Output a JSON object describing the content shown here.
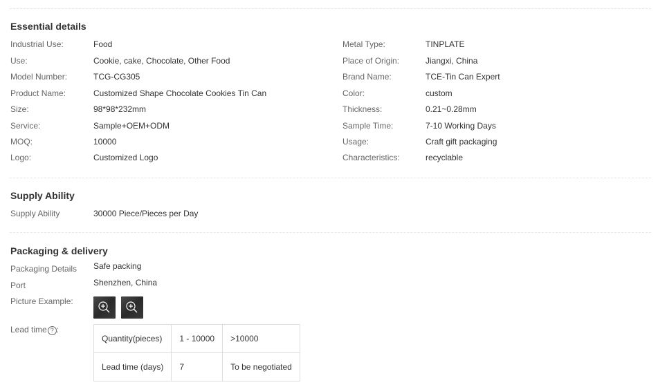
{
  "essential": {
    "title": "Essential details",
    "left": [
      {
        "label": "Industrial Use:",
        "value": "Food"
      },
      {
        "label": "Use:",
        "value": "Cookie, cake, Chocolate, Other Food"
      },
      {
        "label": "Model Number:",
        "value": "TCG-CG305"
      },
      {
        "label": "Product Name:",
        "value": "Customized Shape Chocolate Cookies Tin Can"
      },
      {
        "label": "Size:",
        "value": "98*98*232mm"
      },
      {
        "label": "Service:",
        "value": "Sample+OEM+ODM"
      },
      {
        "label": "MOQ:",
        "value": "10000"
      },
      {
        "label": "Logo:",
        "value": "Customized Logo"
      }
    ],
    "right": [
      {
        "label": "Metal Type:",
        "value": "TINPLATE"
      },
      {
        "label": "Place of Origin:",
        "value": "Jiangxi, China"
      },
      {
        "label": "Brand Name:",
        "value": "TCE-Tin Can Expert"
      },
      {
        "label": "Color:",
        "value": "custom"
      },
      {
        "label": "Thickness:",
        "value": "0.21~0.28mm"
      },
      {
        "label": "Sample Time:",
        "value": "7-10 Working Days"
      },
      {
        "label": "Usage:",
        "value": "Craft gift packaging"
      },
      {
        "label": "Characteristics:",
        "value": "recyclable"
      }
    ]
  },
  "supply": {
    "title": "Supply Ability",
    "label": "Supply Ability",
    "value": "30000 Piece/Pieces per Day"
  },
  "packaging": {
    "title": "Packaging & delivery",
    "details_label": "Packaging Details",
    "details_value": "Safe packing",
    "port_label": "Port",
    "port_value": "Shenzhen, China",
    "picture_label": "Picture Example:",
    "lead_label": "Lead time",
    "lead_help_icon": "question-circle-icon",
    "thumb_icon": "zoom-in-icon",
    "lead_table": {
      "row1": [
        "Quantity(pieces)",
        "1 - 10000",
        ">10000"
      ],
      "row2": [
        "Lead time (days)",
        "7",
        "To be negotiated"
      ]
    }
  }
}
